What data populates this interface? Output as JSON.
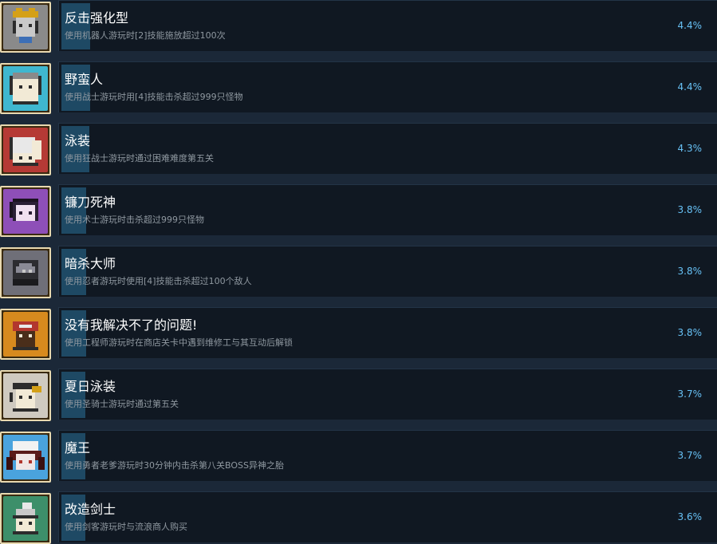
{
  "achievements": [
    {
      "title": "反击强化型",
      "desc": "使用机器人游玩时[2]技能施放超过100次",
      "pct": "4.4%",
      "icon": "robot-icon",
      "icon_bg": "#8a8a8a",
      "progress": 0.044
    },
    {
      "title": "野蛮人",
      "desc": "使用战士游玩时用[4]技能击杀超过999只怪物",
      "pct": "4.4%",
      "icon": "barbarian-icon",
      "icon_bg": "#3fb7cf",
      "progress": 0.044
    },
    {
      "title": "泳装",
      "desc": "使用狂战士游玩时通过困难难度第五关",
      "pct": "4.3%",
      "icon": "swimsuit-icon",
      "icon_bg": "#b53a35",
      "progress": 0.043
    },
    {
      "title": "镰刀死神",
      "desc": "使用术士游玩时击杀超过999只怪物",
      "pct": "3.8%",
      "icon": "reaper-icon",
      "icon_bg": "#8e4fb8",
      "progress": 0.038
    },
    {
      "title": "暗杀大师",
      "desc": "使用忍者游玩时使用[4]技能击杀超过100个敌人",
      "pct": "3.8%",
      "icon": "ninja-icon",
      "icon_bg": "#6f6f78",
      "progress": 0.038
    },
    {
      "title": "没有我解决不了的问题!",
      "desc": "使用工程师游玩时在商店关卡中遇到维修工与其互动后解锁",
      "pct": "3.8%",
      "icon": "engineer-icon",
      "icon_bg": "#d78a1e",
      "progress": 0.038
    },
    {
      "title": "夏日泳装",
      "desc": "使用圣骑士游玩时通过第五关",
      "pct": "3.7%",
      "icon": "paladin-icon",
      "icon_bg": "#cfcac0",
      "progress": 0.037
    },
    {
      "title": "魔王",
      "desc": "使用勇者老爹游玩时30分钟内击杀第八关BOSS异神之胎",
      "pct": "3.7%",
      "icon": "demon-king-icon",
      "icon_bg": "#4aa3dd",
      "progress": 0.037
    },
    {
      "title": "改造剑士",
      "desc": "使用剑客游玩时与流浪商人购买",
      "pct": "3.6%",
      "icon": "swordsman-icon",
      "icon_bg": "#3d8f6a",
      "progress": 0.036
    }
  ]
}
